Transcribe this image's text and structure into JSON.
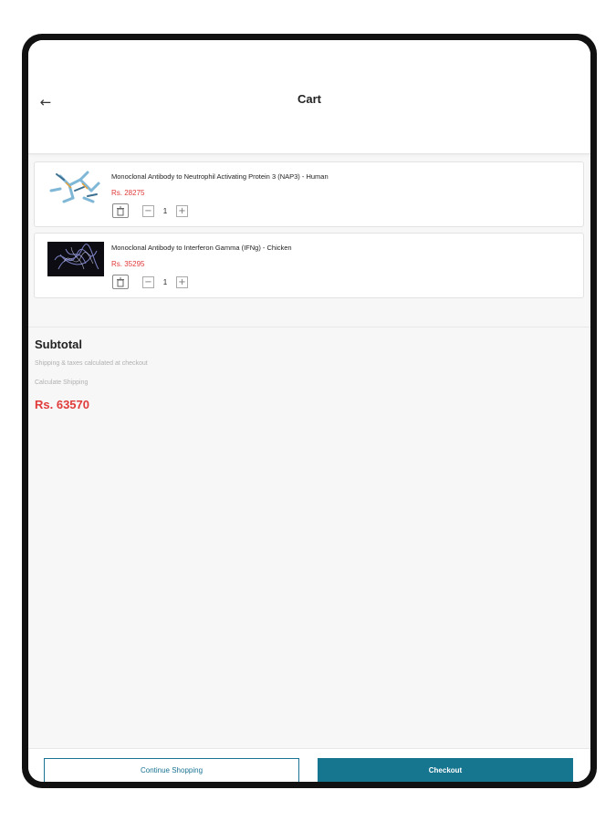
{
  "header": {
    "back_icon": "left-arrow-icon",
    "back_glyph": "←",
    "title": "Cart"
  },
  "cart": {
    "items": [
      {
        "name": "Monoclonal Antibody to Neutrophil Activating Protein 3 (NAP3) - Human",
        "price": "Rs. 28275",
        "quantity": "1",
        "image": "antibody-structure-icon"
      },
      {
        "name": "Monoclonal Antibody to Interferon Gamma (IFNg) - Chicken",
        "price": "Rs. 35295",
        "quantity": "1",
        "image": "protein-render-image"
      }
    ],
    "decrement_glyph": "−",
    "increment_glyph": "+"
  },
  "summary": {
    "title": "Subtotal",
    "shipping_note": "Shipping & taxes calculated at checkout",
    "calculate_shipping": "Calculate Shipping",
    "total": "Rs. 63570"
  },
  "footer": {
    "continue_label": "Continue Shopping",
    "checkout_label": "Checkout"
  },
  "colors": {
    "accent": "#16758f",
    "price": "#e03a3a"
  }
}
